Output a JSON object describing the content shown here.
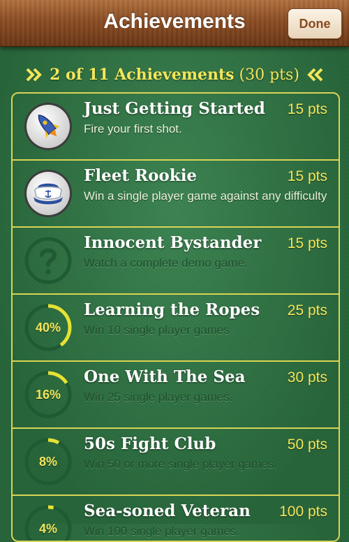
{
  "nav": {
    "title": "Achievements",
    "done_label": "Done"
  },
  "summary": {
    "count_text": "2 of 11 Achievements",
    "points_text": "(30 pts)"
  },
  "colors": {
    "accent_yellow": "#f3e65a",
    "felt_green": "#2f7a45",
    "wood_brown": "#8a4d23",
    "divider": "#d9d455"
  },
  "achievements": [
    {
      "title": "Just Getting Started",
      "points": "15 pts",
      "description": "Fire your first shot.",
      "status": "unlocked",
      "icon": "rocket-icon"
    },
    {
      "title": "Fleet Rookie",
      "points": "15 pts",
      "description": "Win a single player game against any difficulty",
      "status": "unlocked",
      "icon": "sailor-hat-icon"
    },
    {
      "title": "Innocent Bystander",
      "points": "15 pts",
      "description": "Watch a complete demo game.",
      "status": "locked",
      "icon": "question-mark-icon"
    },
    {
      "title": "Learning the Ropes",
      "points": "25 pts",
      "description": "Win 10 single player games",
      "status": "in-progress",
      "progress": 40,
      "progress_label": "40%"
    },
    {
      "title": "One With The Sea",
      "points": "30 pts",
      "description": "Win 25 single player games.",
      "status": "in-progress",
      "progress": 16,
      "progress_label": "16%"
    },
    {
      "title": "50s Fight Club",
      "points": "50 pts",
      "description": "Win 50 or more single player games.",
      "status": "in-progress",
      "progress": 8,
      "progress_label": "8%"
    },
    {
      "title": "Sea-soned Veteran",
      "points": "100 pts",
      "description": "Win 100 single player games.",
      "status": "in-progress",
      "progress": 4,
      "progress_label": "4%"
    }
  ]
}
